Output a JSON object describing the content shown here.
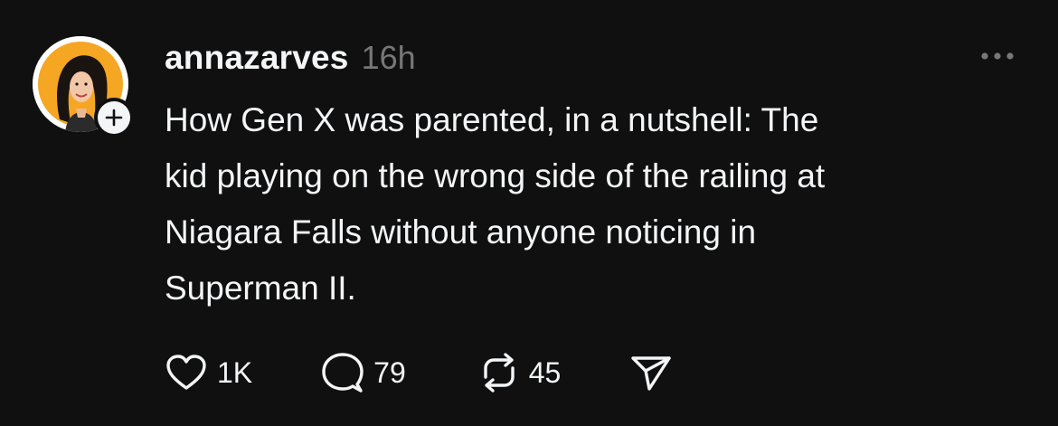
{
  "post": {
    "username": "annazarves",
    "timestamp": "16h",
    "text": "How Gen X was parented, in a nutshell: The\nkid playing on the wrong side of the railing at\nNiagara Falls without anyone noticing in\nSuperman II.",
    "actions": {
      "likes": "1K",
      "replies": "79",
      "reposts": "45"
    },
    "icons": {
      "avatar": "profile-photo",
      "follow": "plus-icon",
      "more": "more-horizontal-icon",
      "like": "heart-icon",
      "reply": "speech-bubble-icon",
      "repost": "repost-icon",
      "share": "send-icon"
    },
    "colors": {
      "background": "#101010",
      "text": "#f3f5f7",
      "muted": "#777777",
      "avatar_bg": "#f5a623"
    }
  }
}
